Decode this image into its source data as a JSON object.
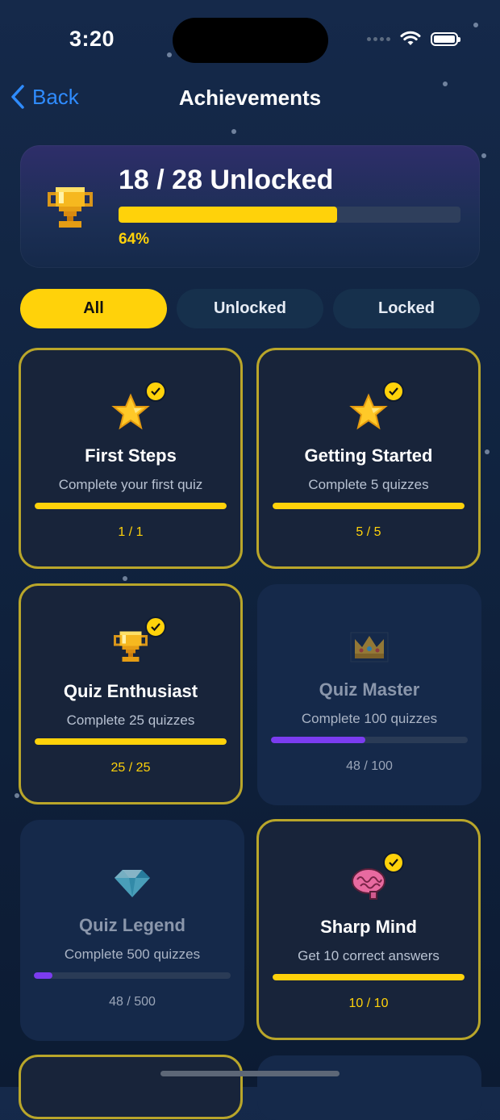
{
  "status": {
    "time": "3:20"
  },
  "nav": {
    "back_label": "Back",
    "title": "Achievements"
  },
  "summary": {
    "count_text": "18 / 28 Unlocked",
    "percent_text": "64%",
    "progress": 0.64,
    "icon": "trophy-icon"
  },
  "tabs": [
    {
      "label": "All",
      "active": true
    },
    {
      "label": "Unlocked",
      "active": false
    },
    {
      "label": "Locked",
      "active": false
    }
  ],
  "achievements": [
    {
      "title": "First Steps",
      "description": "Complete your first quiz",
      "progress_text": "1 / 1",
      "progress": 1.0,
      "unlocked": true,
      "icon": "star-icon"
    },
    {
      "title": "Getting Started",
      "description": "Complete 5 quizzes",
      "progress_text": "5 / 5",
      "progress": 1.0,
      "unlocked": true,
      "icon": "star-icon"
    },
    {
      "title": "Quiz Enthusiast",
      "description": "Complete 25 quizzes",
      "progress_text": "25 / 25",
      "progress": 1.0,
      "unlocked": true,
      "icon": "trophy-icon"
    },
    {
      "title": "Quiz Master",
      "description": "Complete 100 quizzes",
      "progress_text": "48 / 100",
      "progress": 0.48,
      "unlocked": false,
      "icon": "crown-icon"
    },
    {
      "title": "Quiz Legend",
      "description": "Complete 500 quizzes",
      "progress_text": "48 / 500",
      "progress": 0.096,
      "unlocked": false,
      "icon": "diamond-icon"
    },
    {
      "title": "Sharp Mind",
      "description": "Get 10 correct answers",
      "progress_text": "10 / 10",
      "progress": 1.0,
      "unlocked": true,
      "icon": "brain-icon"
    }
  ],
  "colors": {
    "accent": "#ffd20a",
    "locked_progress": "#7b3cf0",
    "link": "#2f8cff"
  }
}
